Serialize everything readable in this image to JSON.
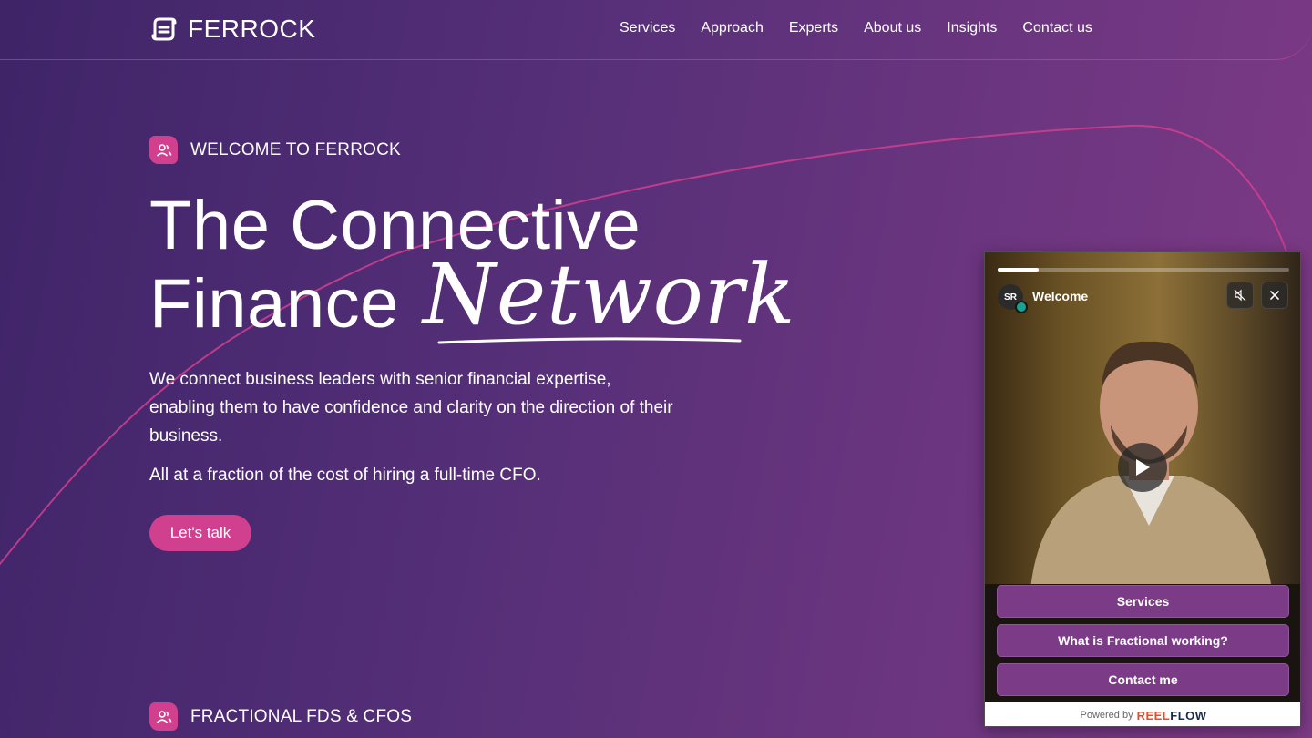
{
  "brand": {
    "name": "FERROCK",
    "accent": "#d13f8f"
  },
  "nav": [
    {
      "label": "Services"
    },
    {
      "label": "Approach"
    },
    {
      "label": "Experts"
    },
    {
      "label": "About us"
    },
    {
      "label": "Insights"
    },
    {
      "label": "Contact us"
    }
  ],
  "hero": {
    "eyebrow": "WELCOME TO FERROCK",
    "title_line1": "The Connective",
    "title_line2_plain": "Finance",
    "title_line2_script": "Network",
    "lead": "We connect business leaders with senior financial expertise, enabling them to have confidence and clarity on the direction of their business.",
    "lead2": "All at a fraction of the cost of hiring a full-time CFO.",
    "cta": "Let's talk"
  },
  "section2": {
    "eyebrow": "FRACTIONAL FDS & CFOS"
  },
  "widget": {
    "avatar_initials": "SR",
    "title": "Welcome",
    "progress": 0.14,
    "options": [
      {
        "label": "Services"
      },
      {
        "label": "What is Fractional working?"
      },
      {
        "label": "Contact me"
      }
    ],
    "powered_by": "Powered by",
    "brand_part1": "REEL",
    "brand_part2": "FLOW"
  }
}
